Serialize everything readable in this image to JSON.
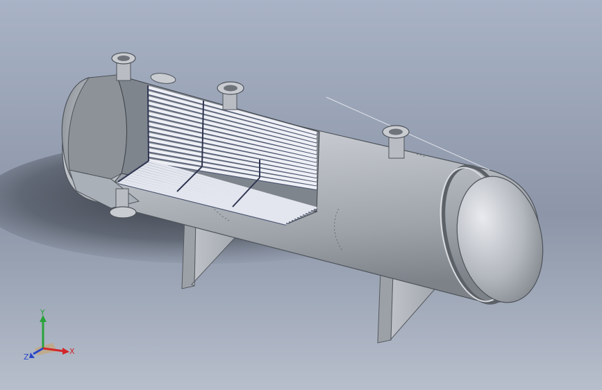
{
  "viewport": {
    "background_top": "#a9b3c6",
    "background_mid": "#8c96a8",
    "background_bottom": "#b7bfcc"
  },
  "model": {
    "shell_color": "#b9bdc3",
    "shell_shadow": "#7d8289",
    "tube_color": "#c8cdd8",
    "tube_edge": "#4a5472",
    "part_icons": [
      "pressure-vessel",
      "tube-bundle",
      "nozzle-flange",
      "saddle-support"
    ]
  },
  "triad": {
    "x_label": "X",
    "y_label": "Y",
    "z_label": "Z",
    "x_color": "#d2262a",
    "y_color": "#2aa23a",
    "z_color": "#2a46c8"
  }
}
